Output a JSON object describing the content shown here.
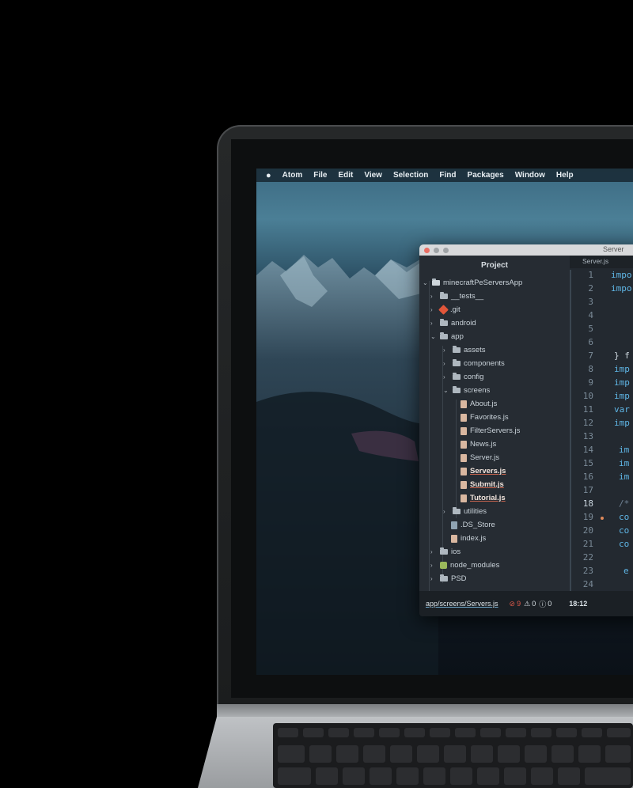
{
  "menubar": {
    "apple": "",
    "app_name": "Atom",
    "items": [
      "File",
      "Edit",
      "View",
      "Selection",
      "Find",
      "Packages",
      "Window",
      "Help"
    ]
  },
  "window": {
    "title": "Server",
    "tab_label": "Server.js"
  },
  "tree": {
    "header": "Project",
    "root": "minecraftPeServersApp",
    "items": [
      {
        "label": "__tests__",
        "kind": "folder"
      },
      {
        "label": ".git",
        "kind": "git"
      },
      {
        "label": "android",
        "kind": "folder"
      },
      {
        "label": "app",
        "kind": "folder-open"
      },
      {
        "label": "assets",
        "kind": "folder"
      },
      {
        "label": "components",
        "kind": "folder"
      },
      {
        "label": "config",
        "kind": "folder"
      },
      {
        "label": "screens",
        "kind": "folder-open"
      },
      {
        "label": "About.js",
        "kind": "file"
      },
      {
        "label": "Favorites.js",
        "kind": "file"
      },
      {
        "label": "FilterServers.js",
        "kind": "file"
      },
      {
        "label": "News.js",
        "kind": "file"
      },
      {
        "label": "Server.js",
        "kind": "file"
      },
      {
        "label": "Servers.js",
        "kind": "file-modified"
      },
      {
        "label": "Submit.js",
        "kind": "file-modified"
      },
      {
        "label": "Tutorial.js",
        "kind": "file-modified"
      },
      {
        "label": "utilities",
        "kind": "folder"
      },
      {
        "label": ".DS_Store",
        "kind": "store"
      },
      {
        "label": "index.js",
        "kind": "file"
      },
      {
        "label": "ios",
        "kind": "folder"
      },
      {
        "label": "node_modules",
        "kind": "node"
      },
      {
        "label": "PSD",
        "kind": "folder"
      }
    ]
  },
  "editor": {
    "line_numbers": [
      "1",
      "2",
      "3",
      "4",
      "5",
      "6",
      "7",
      "8",
      "9",
      "10",
      "11",
      "12",
      "13",
      "14",
      "15",
      "16",
      "17",
      "18",
      "19",
      "20",
      "21",
      "22",
      "23",
      "24"
    ],
    "code_fragments": [
      {
        "line": 1,
        "text": "impo"
      },
      {
        "line": 2,
        "text": "impo"
      },
      {
        "line": 7,
        "text": "} f"
      },
      {
        "line": 8,
        "text": "imp"
      },
      {
        "line": 9,
        "text": "imp"
      },
      {
        "line": 10,
        "text": "imp"
      },
      {
        "line": 11,
        "text": "var"
      },
      {
        "line": 12,
        "text": "imp"
      },
      {
        "line": 14,
        "text": "im"
      },
      {
        "line": 15,
        "text": "im"
      },
      {
        "line": 16,
        "text": "im"
      },
      {
        "line": 18,
        "text": "/*"
      },
      {
        "line": 19,
        "text": "co"
      },
      {
        "line": 20,
        "text": "co"
      },
      {
        "line": 21,
        "text": "co"
      },
      {
        "line": 23,
        "text": "e"
      }
    ]
  },
  "status": {
    "path": "app/screens/Servers.js",
    "errors": "9",
    "warnings": "0",
    "infos": "0",
    "cursor": "18:12"
  },
  "colors": {
    "editor_bg": "#21272d",
    "keyword_blue": "#5fb6e6",
    "error_red": "#e0594a",
    "modified_underline": "#c9654e"
  }
}
